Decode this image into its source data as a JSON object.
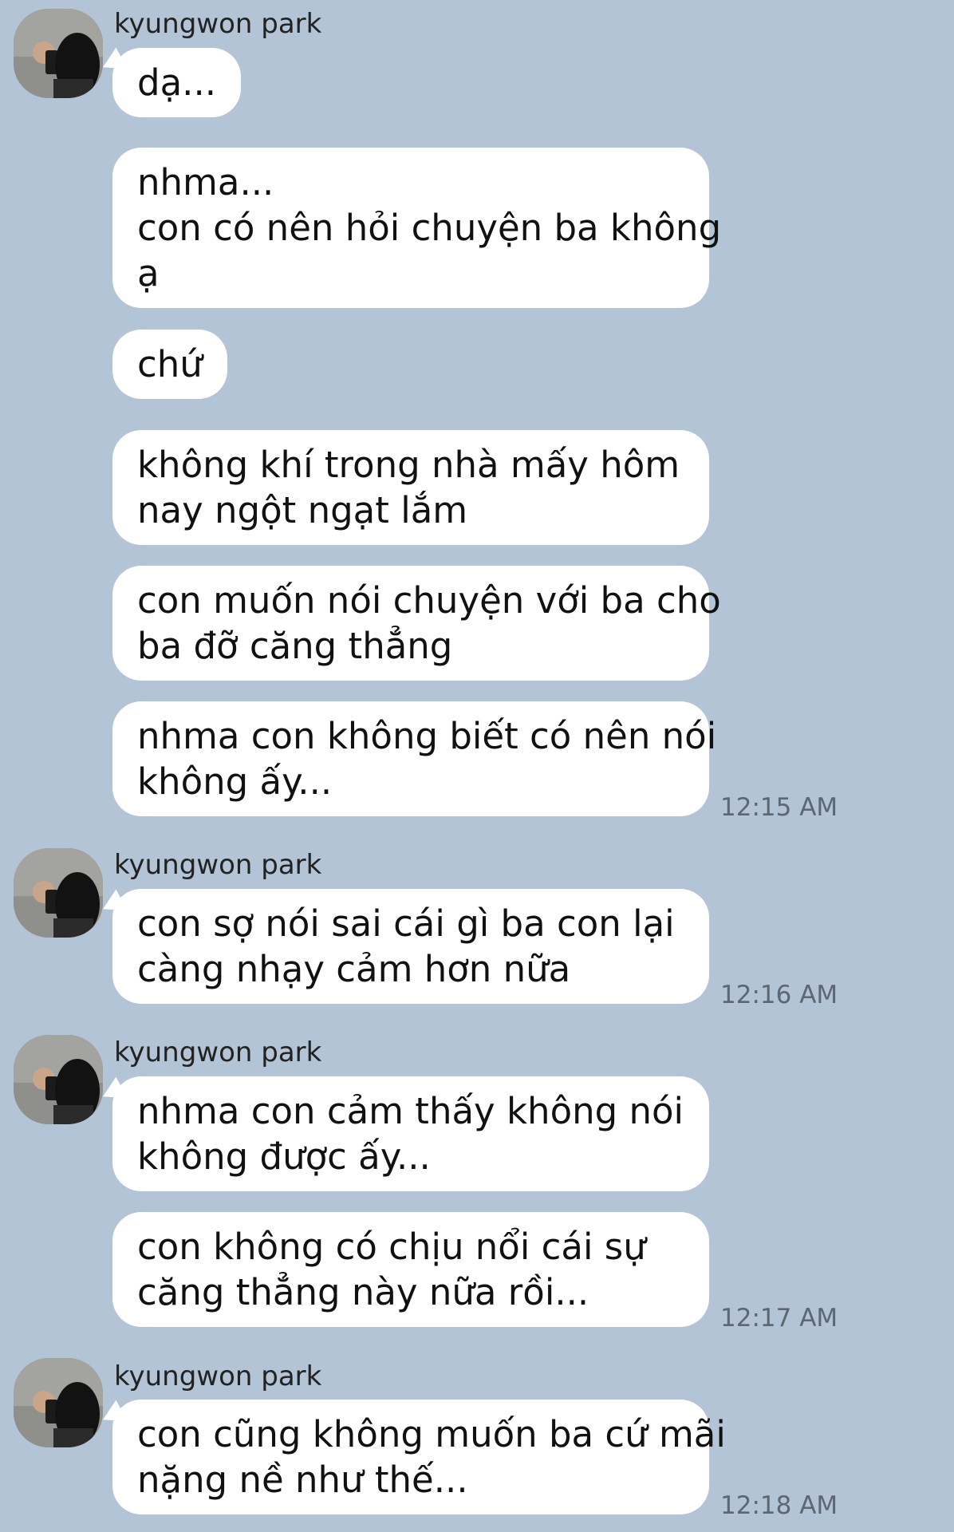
{
  "chat": {
    "groups": [
      {
        "sender": "kyungwon park",
        "messages": [
          {
            "lines": [
              "dạ..."
            ]
          },
          {
            "lines": [
              "nhma...",
              "con có nên hỏi chuyện ba không",
              "ạ"
            ]
          },
          {
            "lines": [
              "chứ"
            ]
          },
          {
            "lines": [
              "không khí trong nhà mấy hôm",
              "nay ngột ngạt lắm"
            ]
          },
          {
            "lines": [
              "con muốn nói chuyện với ba cho",
              "ba đỡ căng thẳng"
            ]
          },
          {
            "lines": [
              "nhma con không biết có nên nói",
              "không ấy..."
            ]
          }
        ],
        "time": "12:15 AM"
      },
      {
        "sender": "kyungwon park",
        "messages": [
          {
            "lines": [
              "con sợ nói sai cái gì ba con lại",
              "càng nhạy cảm hơn nữa"
            ]
          }
        ],
        "time": "12:16 AM"
      },
      {
        "sender": "kyungwon park",
        "messages": [
          {
            "lines": [
              "nhma con cảm thấy không nói",
              "không được ấy..."
            ]
          },
          {
            "lines": [
              "con không có chịu nổi cái sự",
              "căng thẳng này nữa rồi..."
            ]
          }
        ],
        "time": "12:17 AM"
      },
      {
        "sender": "kyungwon park",
        "messages": [
          {
            "lines": [
              "con cũng không muốn ba cứ mãi",
              "nặng nề như thế..."
            ]
          }
        ],
        "time": "12:18 AM"
      }
    ]
  },
  "colors": {
    "background": "#b3c4d6",
    "bubble": "#ffffff",
    "timestamp": "#5c6773"
  }
}
